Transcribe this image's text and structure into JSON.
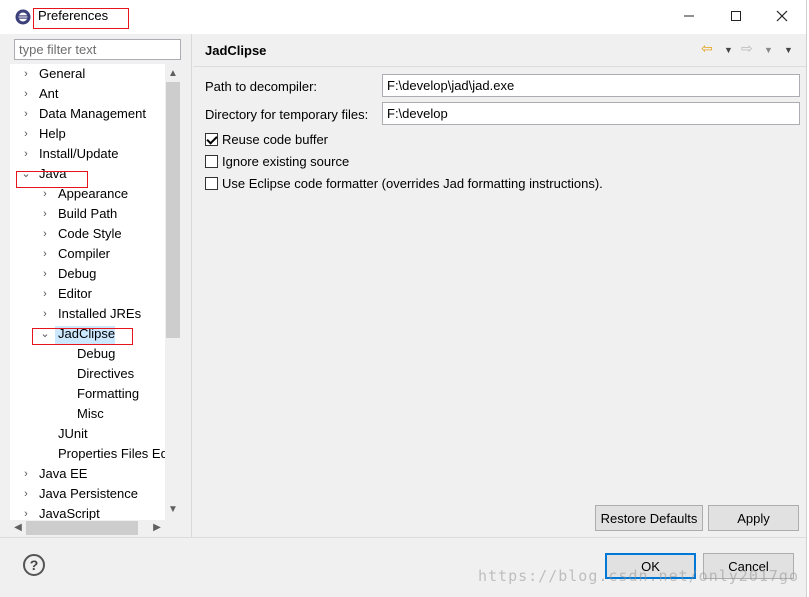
{
  "window": {
    "title": "Preferences",
    "minimize_icon": "minimize-icon",
    "maximize_icon": "maximize-icon",
    "close_icon": "close-icon"
  },
  "filter": {
    "placeholder": "type filter text",
    "value": ""
  },
  "tree": {
    "items": [
      {
        "label": "General",
        "state": "collapsed"
      },
      {
        "label": "Ant",
        "state": "collapsed"
      },
      {
        "label": "Data Management",
        "state": "collapsed"
      },
      {
        "label": "Help",
        "state": "collapsed"
      },
      {
        "label": "Install/Update",
        "state": "collapsed"
      },
      {
        "label": "Java",
        "state": "expanded"
      },
      {
        "label": "Appearance",
        "state": "collapsed"
      },
      {
        "label": "Build Path",
        "state": "collapsed"
      },
      {
        "label": "Code Style",
        "state": "collapsed"
      },
      {
        "label": "Compiler",
        "state": "collapsed"
      },
      {
        "label": "Debug",
        "state": "collapsed"
      },
      {
        "label": "Editor",
        "state": "collapsed"
      },
      {
        "label": "Installed JREs",
        "state": "collapsed"
      },
      {
        "label": "JadClipse",
        "state": "expanded",
        "selected": true
      },
      {
        "label": "Debug",
        "state": "leaf"
      },
      {
        "label": "Directives",
        "state": "leaf"
      },
      {
        "label": "Formatting",
        "state": "leaf"
      },
      {
        "label": "Misc",
        "state": "leaf"
      },
      {
        "label": "JUnit",
        "state": "leaf"
      },
      {
        "label": "Properties Files Ed",
        "state": "leaf"
      },
      {
        "label": "Java EE",
        "state": "collapsed"
      },
      {
        "label": "Java Persistence",
        "state": "collapsed"
      },
      {
        "label": "JavaScript",
        "state": "collapsed"
      }
    ]
  },
  "page": {
    "title": "JadClipse",
    "nav_icons": [
      "back-arrow-icon",
      "dropdown-icon",
      "forward-arrow-icon",
      "dropdown-icon",
      "menu-icon"
    ]
  },
  "fields": {
    "decompiler_label": "Path to decompiler:",
    "decompiler_value": "F:\\develop\\jad\\jad.exe",
    "tempdir_label": "Directory for temporary files:",
    "tempdir_value": "F:\\develop"
  },
  "options": [
    {
      "label": "Reuse code buffer",
      "checked": true
    },
    {
      "label": "Ignore existing source",
      "checked": false
    },
    {
      "label": "Use Eclipse code formatter (overrides Jad formatting instructions).",
      "checked": false
    }
  ],
  "buttons": {
    "restore_defaults": "Restore Defaults",
    "apply": "Apply",
    "ok": "OK",
    "cancel": "Cancel",
    "help": "?"
  },
  "watermark": "https://blog.csdn.net/only2017go",
  "colors": {
    "selection": "#cce8ff",
    "annotation_red": "#e8141c",
    "default_button_border": "#0078d7"
  }
}
